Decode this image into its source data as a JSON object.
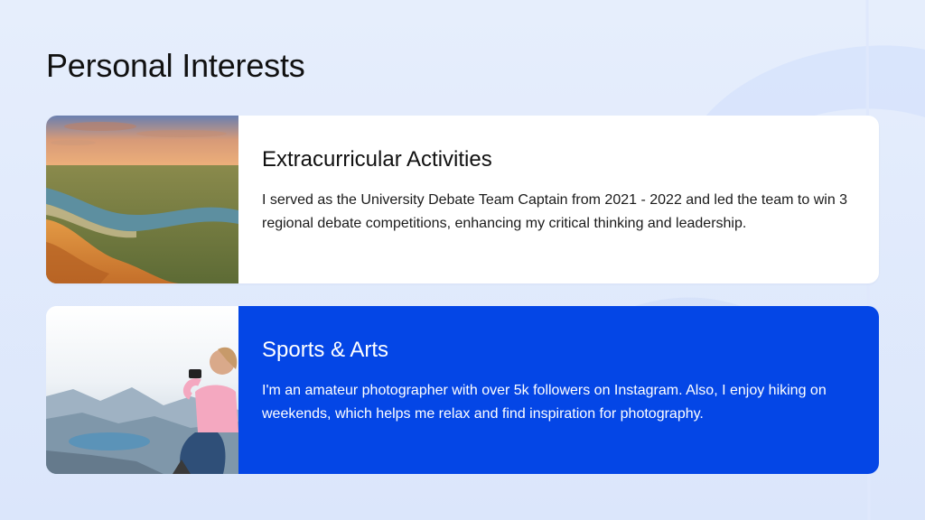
{
  "page": {
    "title": "Personal Interests"
  },
  "cards": [
    {
      "title": "Extracurricular Activities",
      "text": "I served as the University Debate Team Captain from 2021 - 2022 and led the team to win 3 regional debate competitions, enhancing my critical thinking and leadership.",
      "image": "river-canyon-sunset-photo"
    },
    {
      "title": "Sports & Arts",
      "text": "I'm an amateur photographer with over 5k followers on Instagram. Also, I enjoy hiking on weekends, which helps me relax and find inspiration for photography.",
      "image": "hiker-taking-photo-of-mountain-lake"
    }
  ],
  "colors": {
    "background": "#e6eefc",
    "card_light": "#ffffff",
    "card_accent": "#0446e6",
    "title_text": "#111111"
  }
}
